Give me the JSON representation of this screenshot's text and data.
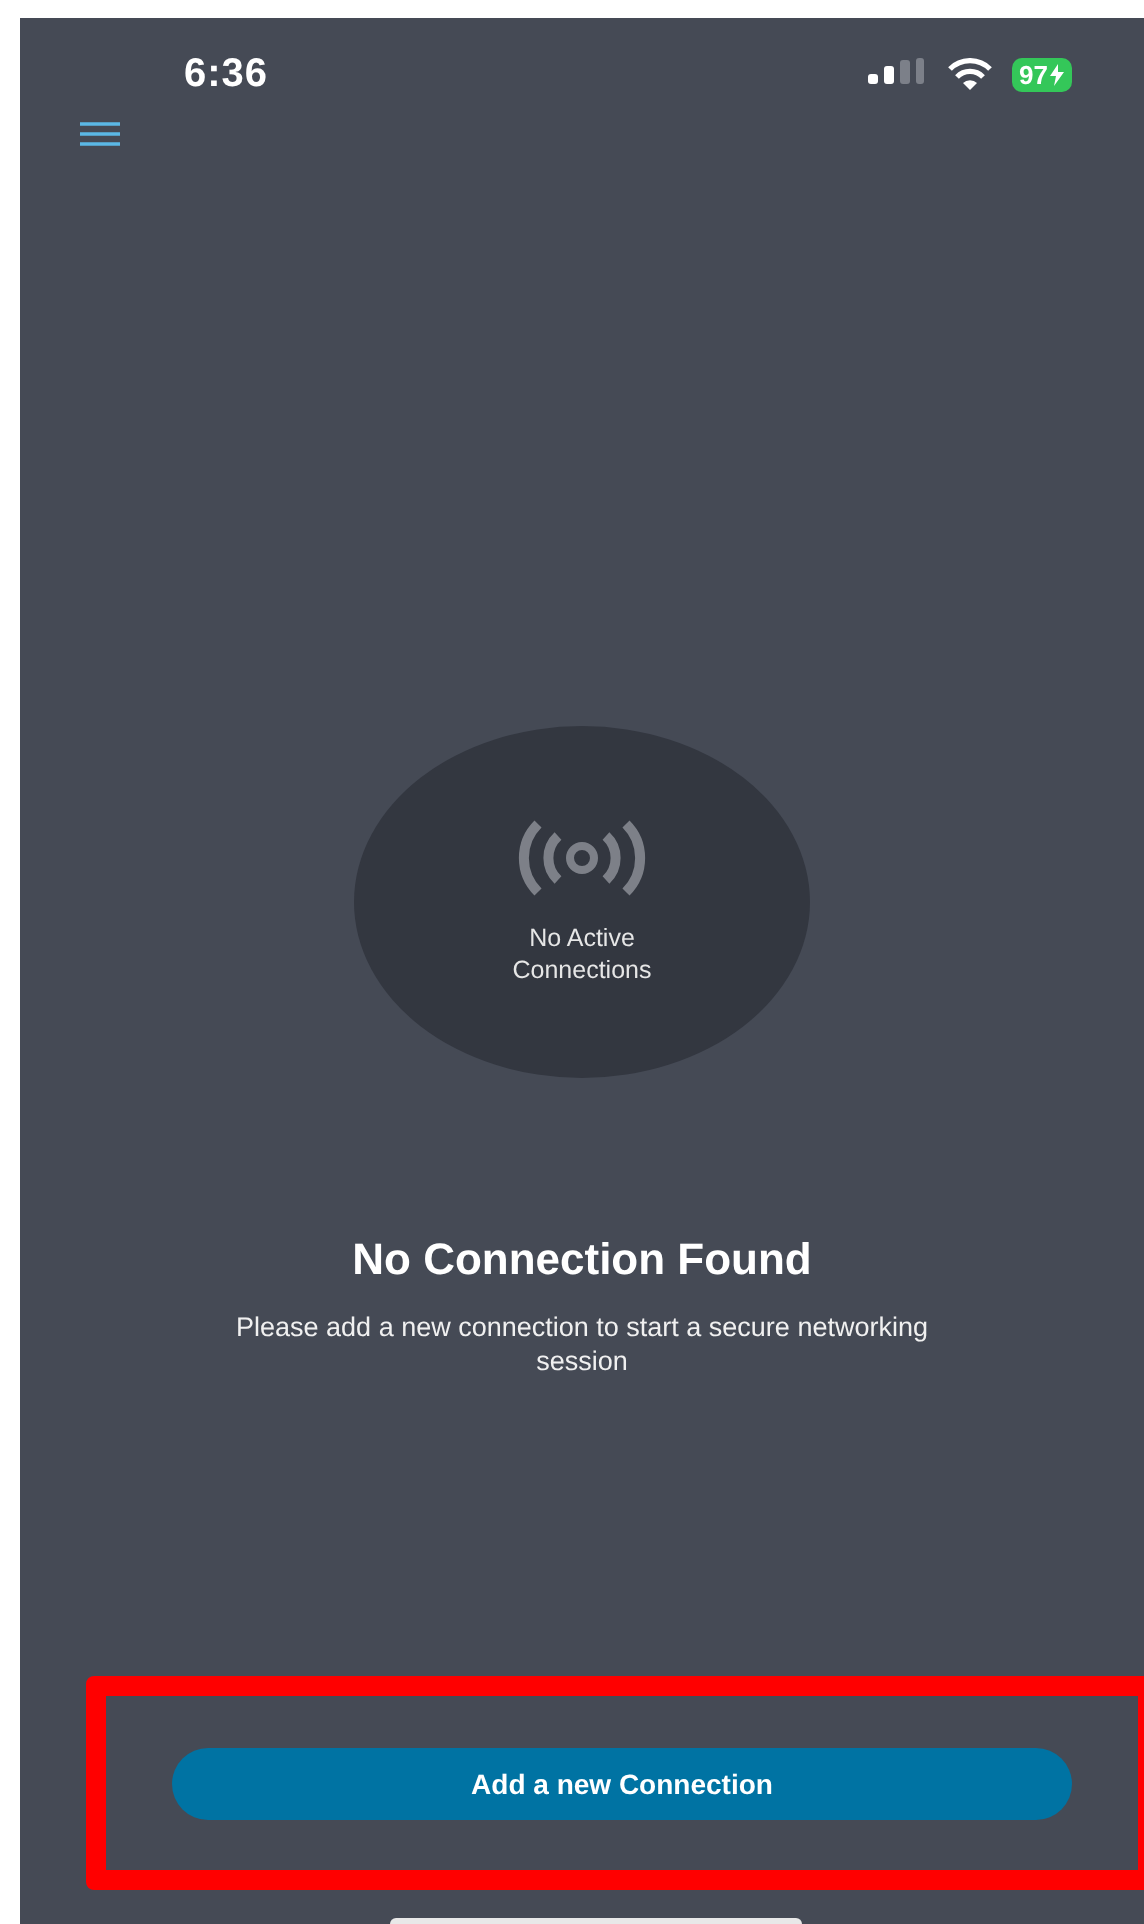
{
  "status_bar": {
    "time": "6:36",
    "battery": "97"
  },
  "empty_state": {
    "badge_text": "No Active Connections",
    "title": "No Connection Found",
    "message": "Please add a new connection to start a secure networking session"
  },
  "action_button": {
    "label": "Add a new Connection"
  }
}
